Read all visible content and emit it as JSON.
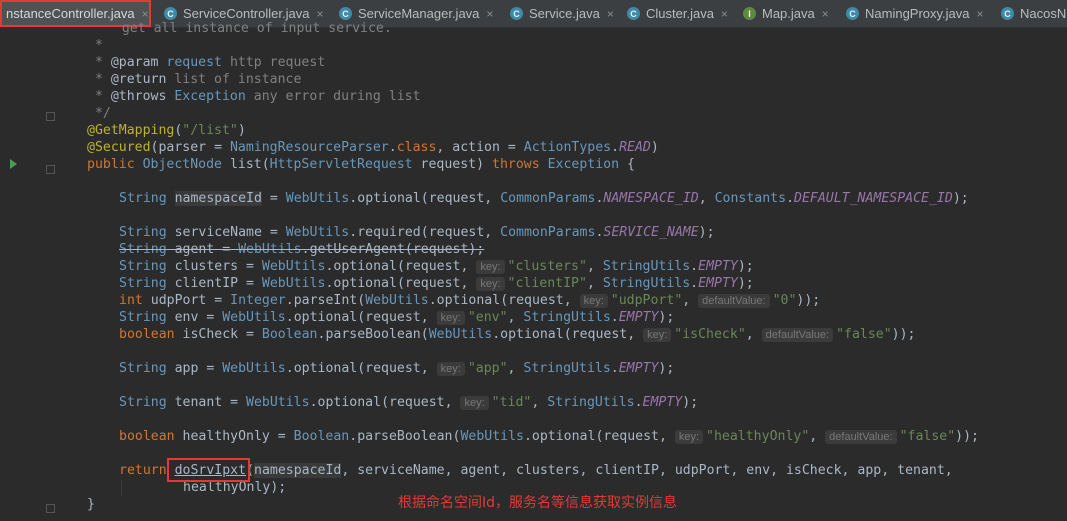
{
  "tabs": [
    {
      "label": "nstanceController.java",
      "icon": "none",
      "active": true
    },
    {
      "label": "ServiceController.java",
      "icon": "C"
    },
    {
      "label": "ServiceManager.java",
      "icon": "C"
    },
    {
      "label": "Service.java",
      "icon": "C"
    },
    {
      "label": "Cluster.java",
      "icon": "C"
    },
    {
      "label": "Map.java",
      "icon": "I"
    },
    {
      "label": "NamingProxy.java",
      "icon": "C"
    },
    {
      "label": "NacosN",
      "icon": "C"
    }
  ],
  "close_glyph": "×",
  "doc": {
    "l0": "   get all instance of input service.",
    "l1": " *",
    "param_tag": "@param",
    "param_name": "request",
    "param_desc": "http request",
    "return_tag": "@return",
    "return_desc": "list of instance",
    "throws_tag": "@throws",
    "throws_name": "Exception",
    "throws_desc": "any error during list",
    "end": " */"
  },
  "code": {
    "getmapping": "@GetMapping",
    "getmapping_arg": "\"/list\"",
    "secured": "@Secured",
    "secured_arg1": "parser",
    "parser_cls": "NamingResourceParser",
    "action": "action",
    "action_cls": "ActionTypes",
    "read": "READ",
    "sig_public": "public",
    "sig_type": "ObjectNode",
    "sig_name": "list",
    "sig_ptype": "HttpServletRequest",
    "sig_pname": "request",
    "sig_throws": "throws",
    "sig_exc": "Exception",
    "namespaceId_var": "namespaceId",
    "webutils": "WebUtils",
    "optional": "optional",
    "required": "required",
    "getUserAgent": "getUserAgent",
    "common": "CommonParams",
    "ns_id": "NAMESPACE_ID",
    "constants": "Constants",
    "def_ns": "DEFAULT_NAMESPACE_ID",
    "service_name": "SERVICE_NAME",
    "stringutils": "StringUtils",
    "empty": "EMPTY",
    "integer": "Integer",
    "parseInt": "parseInt",
    "boolean_cls": "Boolean",
    "parseBoolean": "parseBoolean",
    "hint_key": "key:",
    "hint_default": "defaultValue:",
    "s_clusters": "\"clusters\"",
    "s_clientIP": "\"clientIP\"",
    "s_udpPort": "\"udpPort\"",
    "s_zero": "\"0\"",
    "s_env": "\"env\"",
    "s_isCheck": "\"isCheck\"",
    "s_false": "\"false\"",
    "s_app": "\"app\"",
    "s_tid": "\"tid\"",
    "s_healthyOnly": "\"healthyOnly\"",
    "ret": "return",
    "doSrvIpxt": "doSrvIpxt",
    "ret_args": ", serviceName, agent, clusters, clientIP, udpPort, env, isCheck, app, tenant,",
    "ret_cont": "healthyOnly);",
    "closing": "}"
  },
  "annotation": "根据命名空间Id，服务名等信息获取实例信息",
  "colors": {
    "highlight": "#e53935",
    "keyword": "#cc7832",
    "string": "#6a8759",
    "annotation": "#bbb529"
  }
}
